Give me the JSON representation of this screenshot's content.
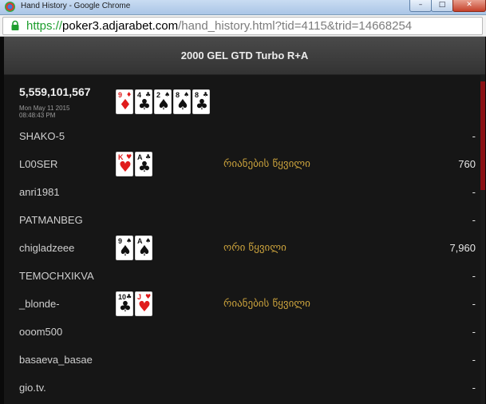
{
  "window": {
    "title": "Hand History - Google Chrome",
    "min_label": "–",
    "max_label": "□",
    "close_label": "✕"
  },
  "address": {
    "scheme": "https",
    "sep": "://",
    "host": "poker3.adjarabet.com",
    "path": "/hand_history.html?tid=4115&trid=14668254"
  },
  "header": {
    "title": "2000 GEL GTD Turbo R+A"
  },
  "hand": {
    "id": "5,559,101,567",
    "date": "Mon May 11 2015",
    "time": "08:48:43 PM",
    "board": [
      {
        "rank": "9",
        "suit": "♦",
        "color": "red"
      },
      {
        "rank": "4",
        "suit": "♣",
        "color": "blk"
      },
      {
        "rank": "2",
        "suit": "♠",
        "color": "blk"
      },
      {
        "rank": "8",
        "suit": "♠",
        "color": "blk"
      },
      {
        "rank": "8",
        "suit": "♣",
        "color": "blk"
      }
    ]
  },
  "players": [
    {
      "name": "SHAKO-5",
      "hand": "",
      "amount": "-",
      "cards": []
    },
    {
      "name": "L00SER",
      "hand": "რიანების წყვილი",
      "amount": "760",
      "cards": [
        {
          "rank": "K",
          "suit": "♥",
          "color": "red"
        },
        {
          "rank": "A",
          "suit": "♣",
          "color": "blk"
        }
      ]
    },
    {
      "name": "anri1981",
      "hand": "",
      "amount": "-",
      "cards": []
    },
    {
      "name": "PATMANBEG",
      "hand": "",
      "amount": "-",
      "cards": []
    },
    {
      "name": "chigladzeee",
      "hand": "ორი წყვილი",
      "amount": "7,960",
      "cards": [
        {
          "rank": "9",
          "suit": "♠",
          "color": "blk"
        },
        {
          "rank": "A",
          "suit": "♠",
          "color": "blk"
        }
      ]
    },
    {
      "name": "TEMOCHXIKVA",
      "hand": "",
      "amount": "-",
      "cards": []
    },
    {
      "name": "_blonde-",
      "hand": "რიანების წყვილი",
      "amount": "-",
      "cards": [
        {
          "rank": "10",
          "suit": "♣",
          "color": "blk"
        },
        {
          "rank": "J",
          "suit": "♥",
          "color": "red"
        }
      ]
    },
    {
      "name": "ooom500",
      "hand": "",
      "amount": "-",
      "cards": []
    },
    {
      "name": "basaeva_basae",
      "hand": "",
      "amount": "-",
      "cards": []
    },
    {
      "name": "gio.tv.",
      "hand": "",
      "amount": "-",
      "cards": []
    }
  ],
  "colors": {
    "background": "#161616",
    "header": "#3c3c3c",
    "hand_name": "#c9a13c",
    "scroll_thumb": "#8b1014",
    "url_secure": "#1e9e2e"
  }
}
